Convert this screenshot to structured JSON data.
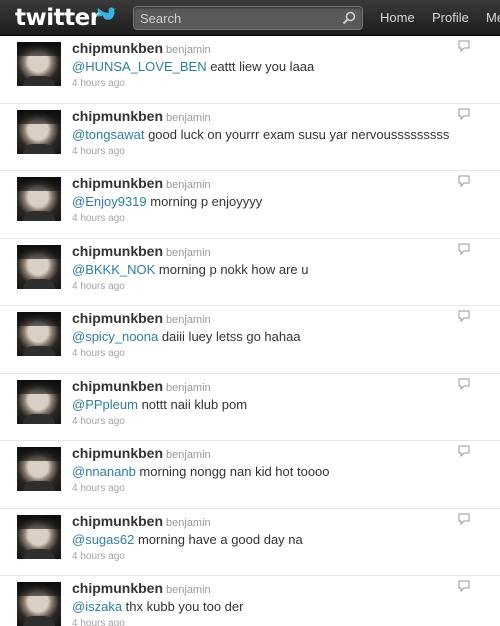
{
  "header": {
    "logo_text": "twitter",
    "search_placeholder": "Search",
    "nav": [
      "Home",
      "Profile",
      "Me"
    ]
  },
  "colors": {
    "mention": "#2a7ea8",
    "topbar": "#2a2a2a",
    "logo_bird": "#33b5e5"
  },
  "tweets": [
    {
      "screen_name": "chipmunkben",
      "full_name": "benjamin",
      "mention": "@HUNSA_LOVE_BEN",
      "text": " eattt liew you laaa",
      "time": "4 hours ago"
    },
    {
      "screen_name": "chipmunkben",
      "full_name": "benjamin",
      "mention": "@tongsawat",
      "text": " good luck on yourrr exam susu yar nervousssssssss",
      "time": "4 hours ago"
    },
    {
      "screen_name": "chipmunkben",
      "full_name": "benjamin",
      "mention": "@Enjoy9319",
      "text": " morning p enjoyyyy",
      "time": "4 hours ago"
    },
    {
      "screen_name": "chipmunkben",
      "full_name": "benjamin",
      "mention": "@BKKK_NOK",
      "text": " morning p nokk how are u",
      "time": "4 hours ago"
    },
    {
      "screen_name": "chipmunkben",
      "full_name": "benjamin",
      "mention": "@spicy_noona",
      "text": " daiii luey letss go hahaa",
      "time": "4 hours ago"
    },
    {
      "screen_name": "chipmunkben",
      "full_name": "benjamin",
      "mention": "@PPpleum",
      "text": " nottt naii klub pom",
      "time": "4 hours ago"
    },
    {
      "screen_name": "chipmunkben",
      "full_name": "benjamin",
      "mention": "@nnananb",
      "text": " morning nongg nan kid hot toooo",
      "time": "4 hours ago"
    },
    {
      "screen_name": "chipmunkben",
      "full_name": "benjamin",
      "mention": "@sugas62",
      "text": " morning have a good day na",
      "time": "4 hours ago"
    },
    {
      "screen_name": "chipmunkben",
      "full_name": "benjamin",
      "mention": "@iszaka",
      "text": " thx kubb you too der",
      "time": "4 hours ago"
    }
  ]
}
